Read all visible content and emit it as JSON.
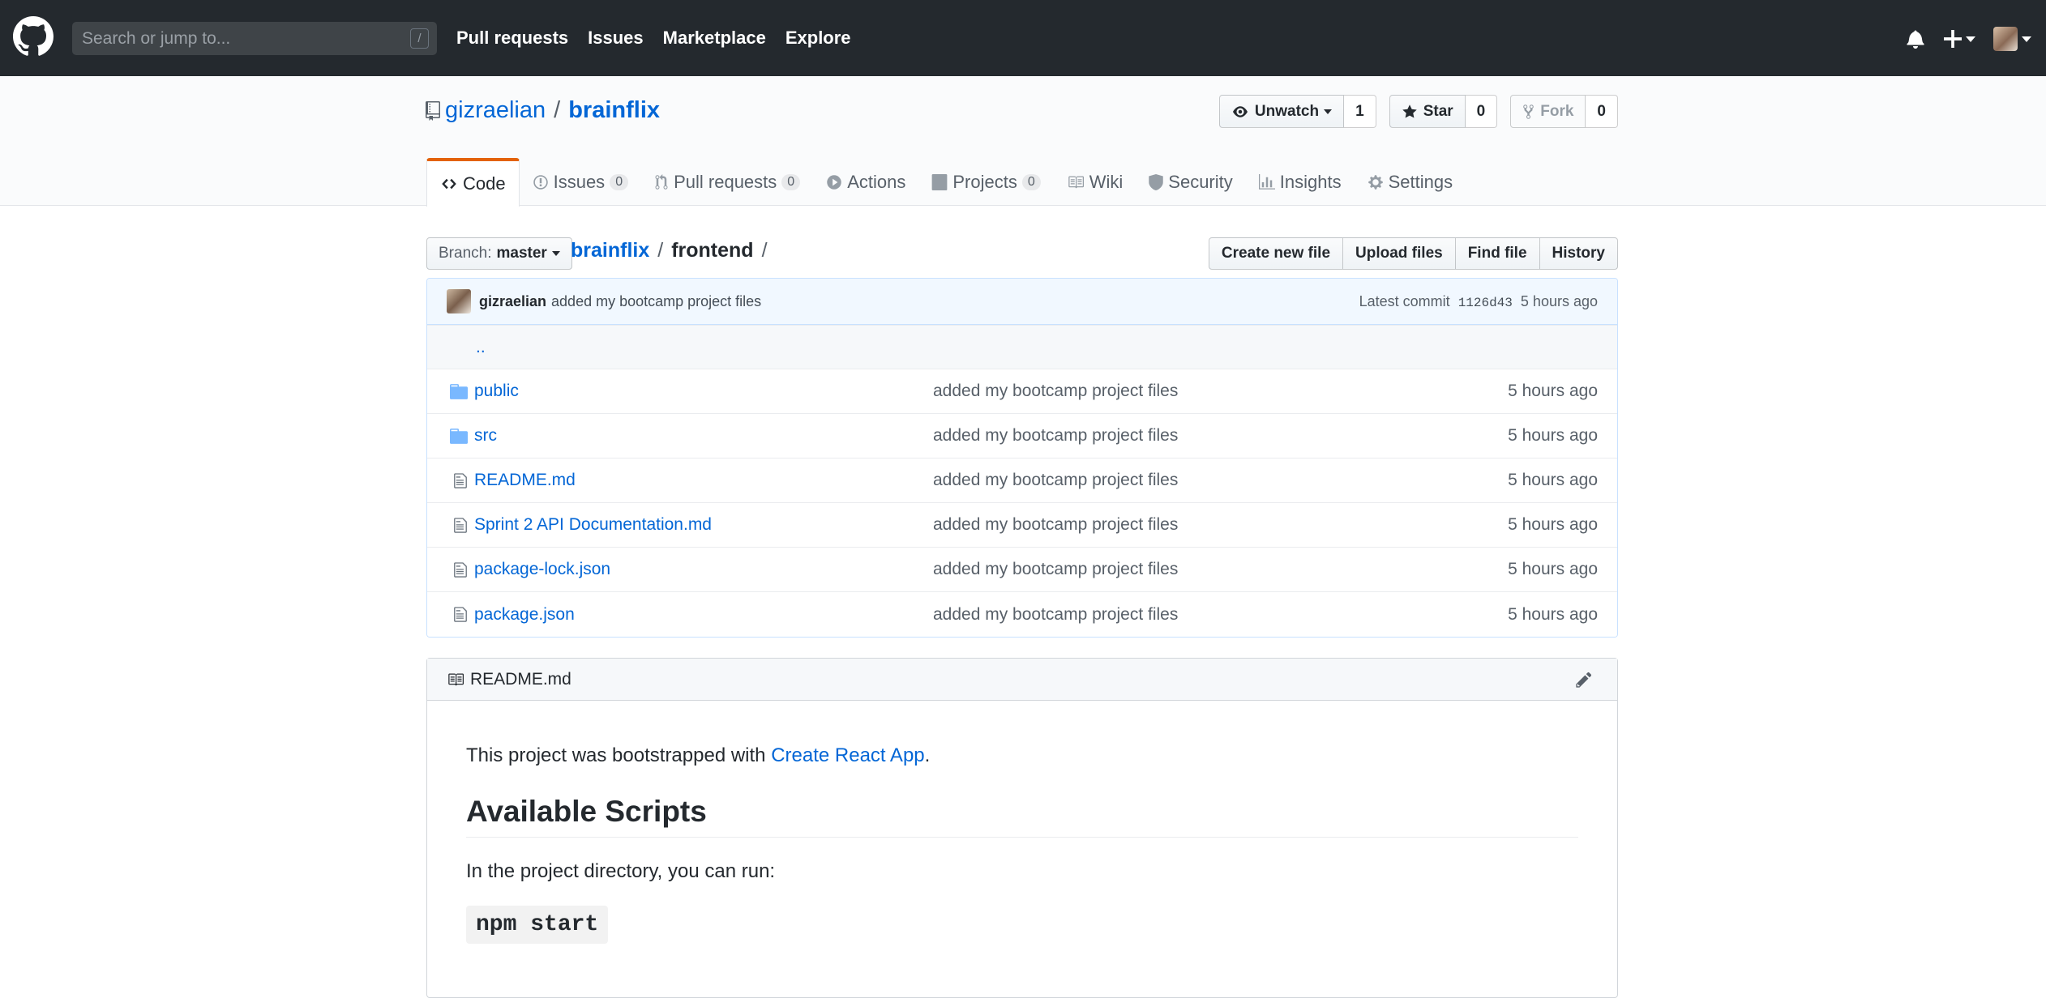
{
  "header": {
    "search_placeholder": "Search or jump to...",
    "search_key": "/",
    "nav": [
      "Pull requests",
      "Issues",
      "Marketplace",
      "Explore"
    ]
  },
  "repo": {
    "owner": "gizraelian",
    "separator": "/",
    "name": "brainflix",
    "watch_label": "Unwatch",
    "watch_count": "1",
    "star_label": "Star",
    "star_count": "0",
    "fork_label": "Fork",
    "fork_count": "0"
  },
  "tabs": [
    {
      "label": "Code",
      "icon": "code-icon",
      "selected": true
    },
    {
      "label": "Issues",
      "icon": "issue-icon",
      "counter": "0"
    },
    {
      "label": "Pull requests",
      "icon": "pull-request-icon",
      "counter": "0"
    },
    {
      "label": "Actions",
      "icon": "play-icon"
    },
    {
      "label": "Projects",
      "icon": "project-icon",
      "counter": "0"
    },
    {
      "label": "Wiki",
      "icon": "book-icon"
    },
    {
      "label": "Security",
      "icon": "shield-icon"
    },
    {
      "label": "Insights",
      "icon": "graph-icon"
    },
    {
      "label": "Settings",
      "icon": "gear-icon"
    }
  ],
  "filenav": {
    "branch_prefix": "Branch:",
    "branch": "master",
    "breadcrumb_root": "brainflix",
    "breadcrumb_current": "frontend",
    "separator": "/",
    "buttons": [
      "Create new file",
      "Upload files",
      "Find file",
      "History"
    ]
  },
  "commit": {
    "author": "gizraelian",
    "message": "added my bootcamp project files",
    "latest_label": "Latest commit",
    "sha": "1126d43",
    "age": "5 hours ago"
  },
  "files": {
    "parent_link": "..",
    "rows": [
      {
        "name": "public",
        "type": "directory",
        "message": "added my bootcamp project files",
        "age": "5 hours ago"
      },
      {
        "name": "src",
        "type": "directory",
        "message": "added my bootcamp project files",
        "age": "5 hours ago"
      },
      {
        "name": "README.md",
        "type": "file",
        "message": "added my bootcamp project files",
        "age": "5 hours ago"
      },
      {
        "name": "Sprint 2 API Documentation.md",
        "type": "file",
        "message": "added my bootcamp project files",
        "age": "5 hours ago"
      },
      {
        "name": "package-lock.json",
        "type": "file",
        "message": "added my bootcamp project files",
        "age": "5 hours ago"
      },
      {
        "name": "package.json",
        "type": "file",
        "message": "added my bootcamp project files",
        "age": "5 hours ago"
      }
    ]
  },
  "readme": {
    "filename": "README.md",
    "intro_before": "This project was bootstrapped with ",
    "intro_link": "Create React App",
    "intro_after": ".",
    "heading": "Available Scripts",
    "para": "In the project directory, you can run:",
    "code": "npm start"
  },
  "colors": {
    "header_bg": "#24292e",
    "link": "#0366d6",
    "tab_accent": "#e36209",
    "folder": "#79b8ff"
  }
}
